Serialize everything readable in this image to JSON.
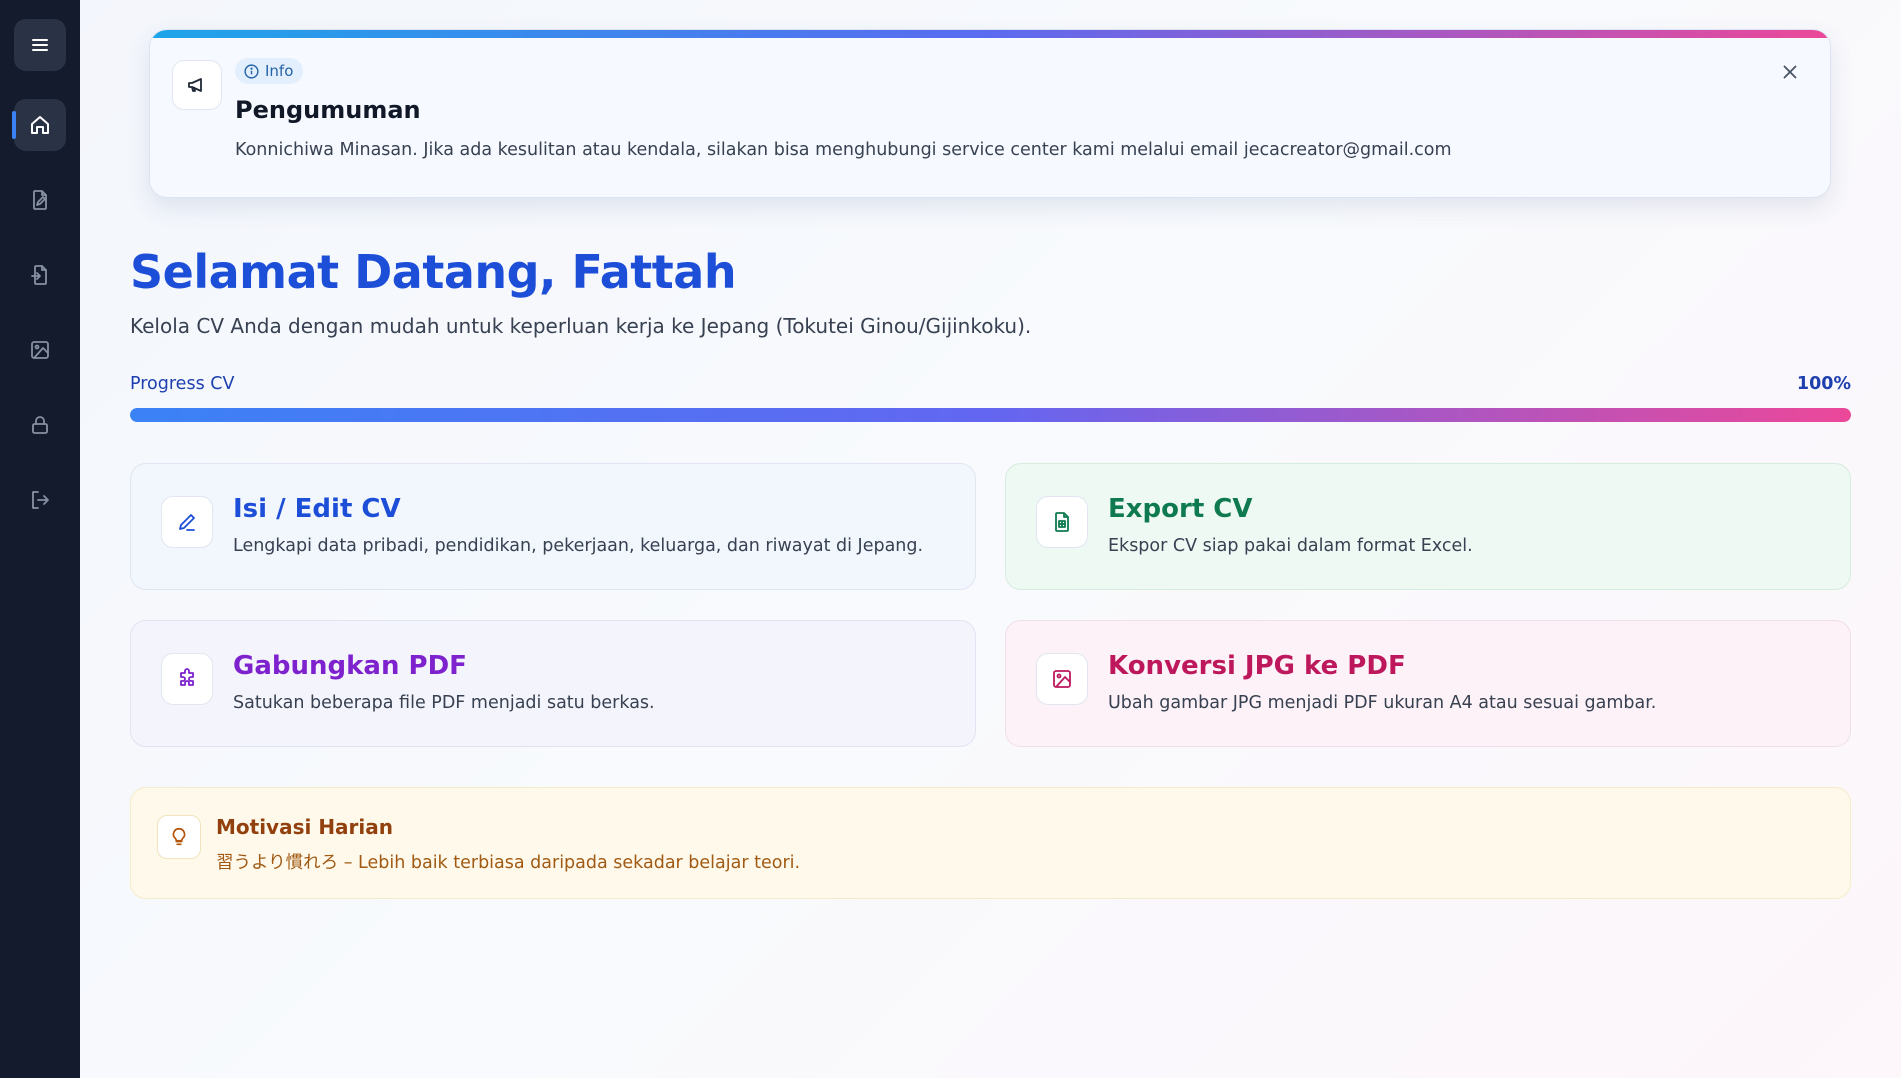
{
  "sidebar": {
    "items": [
      {
        "name": "menu",
        "icon": "menu-icon"
      },
      {
        "name": "home",
        "icon": "home-icon",
        "active": true
      },
      {
        "name": "edit-cv",
        "icon": "file-edit-icon"
      },
      {
        "name": "export",
        "icon": "file-export-icon"
      },
      {
        "name": "image",
        "icon": "image-icon"
      },
      {
        "name": "lock",
        "icon": "lock-icon"
      },
      {
        "name": "logout",
        "icon": "logout-icon"
      }
    ]
  },
  "announcement": {
    "badge": "Info",
    "title": "Pengumuman",
    "message": "Konnichiwa Minasan. Jika ada kesulitan atau kendala, silakan bisa menghubungi service center kami melalui email jecacreator@gmail.com",
    "icon": "megaphone-icon"
  },
  "welcome": {
    "title": "Selamat Datang, Fattah",
    "subtitle": "Kelola CV Anda dengan mudah untuk keperluan kerja ke Jepang (Tokutei Ginou/Gijinkoku)."
  },
  "progress": {
    "label": "Progress CV",
    "value_text": "100%",
    "value": 1.0
  },
  "cards": [
    {
      "title": "Isi / Edit CV",
      "desc": "Lengkapi data pribadi, pendidikan, pekerjaan, keluarga, dan riwayat di Jepang.",
      "icon": "pencil-icon",
      "color": "#1d4ed8"
    },
    {
      "title": "Export CV",
      "desc": "Ekspor CV siap pakai dalam format Excel.",
      "icon": "spreadsheet-icon",
      "color": "#0f7a4f"
    },
    {
      "title": "Gabungkan PDF",
      "desc": "Satukan beberapa file PDF menjadi satu berkas.",
      "icon": "puzzle-icon",
      "color": "#7e22ce"
    },
    {
      "title": "Konversi JPG ke PDF",
      "desc": "Ubah gambar JPG menjadi PDF ukuran A4 atau sesuai gambar.",
      "icon": "image-icon",
      "color": "#be185d"
    }
  ],
  "motivation": {
    "title": "Motivasi Harian",
    "quote": "習うより慣れろ – Lebih baik terbiasa daripada sekadar belajar teori.",
    "icon": "lightbulb-icon"
  }
}
